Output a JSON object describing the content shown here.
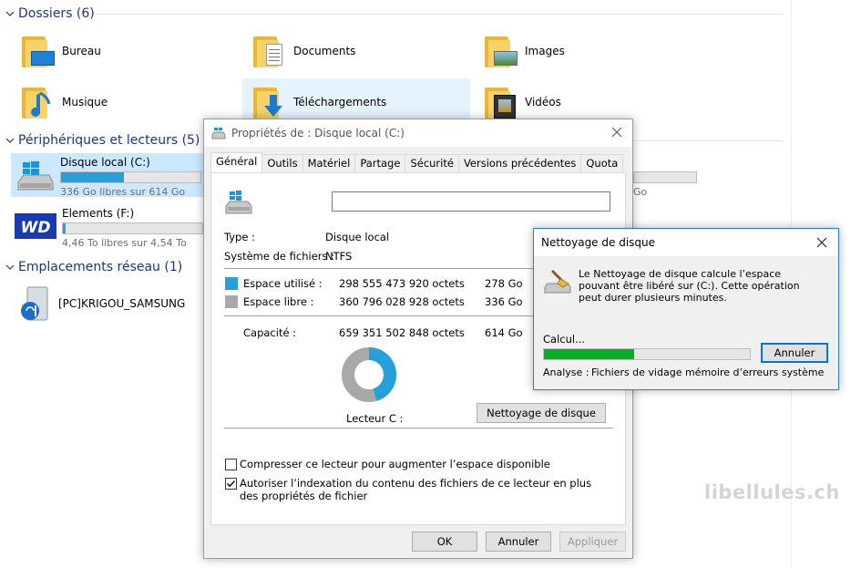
{
  "groups": {
    "folders": {
      "label": "Dossiers (6)"
    },
    "devices": {
      "label": "Périphériques et lecteurs (5)"
    },
    "network": {
      "label": "Emplacements réseau (1)"
    }
  },
  "folders": [
    {
      "name": "Bureau"
    },
    {
      "name": "Documents"
    },
    {
      "name": "Images"
    },
    {
      "name": "Musique"
    },
    {
      "name": "Téléchargements"
    },
    {
      "name": "Vidéos"
    }
  ],
  "drives": [
    {
      "name": "Disque local (C:)",
      "free": "336 Go libres sur 614 Go",
      "used_fraction": 0.453
    },
    {
      "name": "Elements (F:)",
      "free": "4,46 To libres sur 4,54 To",
      "used_fraction": 0.018
    }
  ],
  "hidden_drive_sub": "Go",
  "network_items": [
    {
      "name": "[PC]KRIGOU_SAMSUNG"
    }
  ],
  "properties": {
    "title": "Propriétés de : Disque local (C:)",
    "tabs": [
      "Général",
      "Outils",
      "Matériel",
      "Partage",
      "Sécurité",
      "Versions précédentes",
      "Quota"
    ],
    "type_label": "Type :",
    "type_value": "Disque local",
    "fs_label": "Système de fichiers :",
    "fs_value": "NTFS",
    "used_label": "Espace utilisé :",
    "used_bytes": "298 555 473 920 octets",
    "used_gb": "278 Go",
    "free_label": "Espace libre :",
    "free_bytes": "360 796 028 928 octets",
    "free_gb": "336 Go",
    "capacity_label": "Capacité :",
    "capacity_bytes": "659 351 502 848 octets",
    "capacity_gb": "614 Go",
    "drive_label": "Lecteur C :",
    "cleanup_button": "Nettoyage de disque",
    "compress_label": "Compresser ce lecteur pour augmenter l’espace disponible",
    "index_label": "Autoriser l’indexation du contenu des fichiers de ce lecteur en plus des propriétés de fichier",
    "compress_checked": false,
    "index_checked": true,
    "used_fraction": 0.453,
    "ok": "OK",
    "cancel": "Annuler",
    "apply": "Appliquer",
    "used_color": "#26a0da",
    "free_color": "#a9a9a9"
  },
  "cleanup": {
    "title": "Nettoyage de disque",
    "message": "Le Nettoyage de disque calcule l’espace pouvant être libéré sur  (C:). Cette opération peut durer plusieurs minutes.",
    "calc_label": "Calcul...",
    "cancel": "Annuler",
    "analyse_label": "Analyse :",
    "analyse_value": "Fichiers de vidage mémoire d’erreurs système",
    "progress": 0.44
  },
  "watermark": "libellules.ch"
}
